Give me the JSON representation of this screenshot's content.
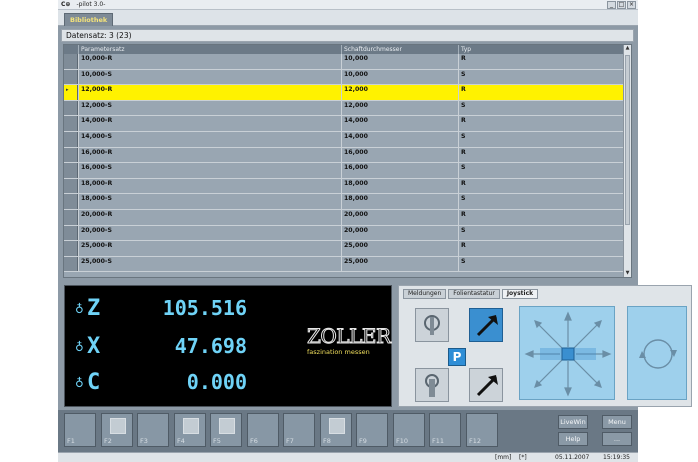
{
  "window": {
    "icon_text": "C⊕",
    "title": "-pilot 3.0-"
  },
  "tabs": [
    {
      "label": "Bibliothek",
      "active": true
    }
  ],
  "record_count": "Datensatz: 3 (23)",
  "table": {
    "columns": [
      "Parametersatz",
      "Schaftdurchmesser",
      "Typ"
    ],
    "selected_index": 2,
    "selected_marker": "▸",
    "rows": [
      [
        "10,000-R",
        "10,000",
        "R"
      ],
      [
        "10,000-S",
        "10,000",
        "S"
      ],
      [
        "12,000-R",
        "12,000",
        "R"
      ],
      [
        "12,000-S",
        "12,000",
        "S"
      ],
      [
        "14,000-R",
        "14,000",
        "R"
      ],
      [
        "14,000-S",
        "14,000",
        "S"
      ],
      [
        "16,000-R",
        "16,000",
        "R"
      ],
      [
        "16,000-S",
        "16,000",
        "S"
      ],
      [
        "18,000-R",
        "18,000",
        "R"
      ],
      [
        "18,000-S",
        "18,000",
        "S"
      ],
      [
        "20,000-R",
        "20,000",
        "R"
      ],
      [
        "20,000-S",
        "20,000",
        "S"
      ],
      [
        "25,000-R",
        "25,000",
        "R"
      ],
      [
        "25,000-S",
        "25,000",
        "S"
      ]
    ]
  },
  "readout": {
    "axes": [
      {
        "label": "Z",
        "value": "105.516"
      },
      {
        "label": "X",
        "value": "47.698"
      },
      {
        "label": "C",
        "value": "0.000"
      }
    ],
    "brand": "ZOLLER",
    "tagline": "faszination messen",
    "color": "#6fd3f7"
  },
  "control_panel": {
    "tabs": [
      {
        "label": "Meldungen",
        "active": false
      },
      {
        "label": "Folientastatur",
        "active": false
      },
      {
        "label": "Joystick",
        "active": true
      }
    ],
    "park_label": "P"
  },
  "function_keys": [
    "F1",
    "F2",
    "F3",
    "F4",
    "F5",
    "F6",
    "F7",
    "F8",
    "F9",
    "F10",
    "F11",
    "F12"
  ],
  "side_buttons": {
    "livewin": "LiveWin",
    "menu": "Menu",
    "help": "Help",
    "more": "..."
  },
  "status_bar": {
    "unit": "[mm]",
    "flag": "[*]",
    "date": "05.11.2007",
    "time": "15:19:35"
  },
  "colors": {
    "selection": "#fff200",
    "tab_text": "#f5e47a",
    "accent_blue": "#3a8fd0"
  }
}
